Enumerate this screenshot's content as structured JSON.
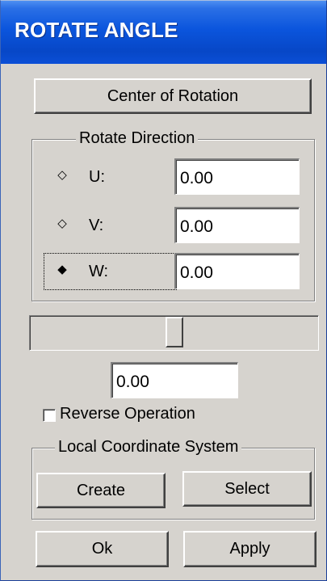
{
  "window": {
    "title": "ROTATE ANGLE"
  },
  "center_button": {
    "label": "Center of Rotation"
  },
  "rotate_direction": {
    "legend": "Rotate Direction",
    "options": [
      {
        "label": "U:",
        "value": "0.00",
        "selected": false
      },
      {
        "label": "V:",
        "value": "0.00",
        "selected": false
      },
      {
        "label": "W:",
        "value": "0.00",
        "selected": true
      }
    ]
  },
  "slider": {
    "position_fraction": 0.5
  },
  "angle_value": "0.00",
  "reverse_operation": {
    "label": "Reverse Operation",
    "checked": false
  },
  "local_coordinate_system": {
    "legend": "Local Coordinate System",
    "create_label": "Create",
    "select_label": "Select"
  },
  "footer": {
    "ok_label": "Ok",
    "apply_label": "Apply"
  },
  "colors": {
    "titlebar": "#0a54dc",
    "face": "#d6d3ce"
  },
  "icons": {
    "radio_unselected": "diamond-outline-icon",
    "radio_selected": "diamond-filled-icon"
  }
}
